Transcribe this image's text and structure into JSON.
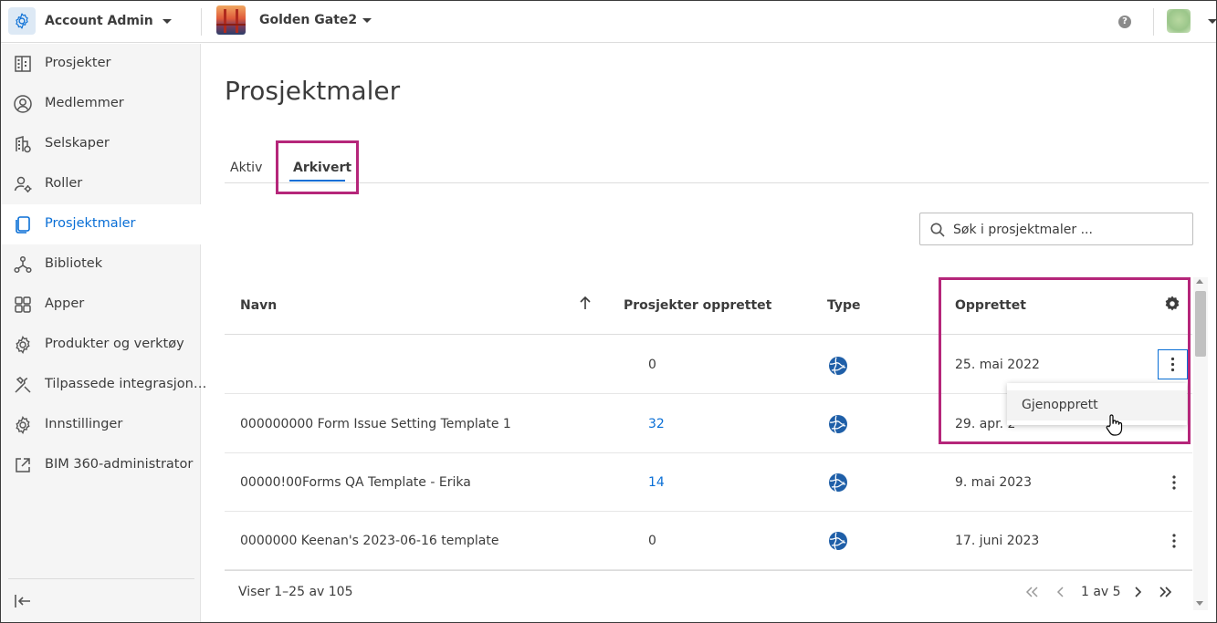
{
  "header": {
    "account_name": "Account Admin",
    "project_name": "Golden Gate2",
    "help_label": "?"
  },
  "sidebar": {
    "items": [
      {
        "label": "Prosjekter",
        "icon": "building-icon"
      },
      {
        "label": "Medlemmer",
        "icon": "user-circle-icon"
      },
      {
        "label": "Selskaper",
        "icon": "company-icon"
      },
      {
        "label": "Roller",
        "icon": "user-gear-icon"
      },
      {
        "label": "Prosjektmaler",
        "icon": "template-icon",
        "active": true
      },
      {
        "label": "Bibliotek",
        "icon": "library-icon"
      },
      {
        "label": "Apper",
        "icon": "apps-icon"
      },
      {
        "label": "Produkter og verktøy",
        "icon": "product-gear-icon"
      },
      {
        "label": "Tilpassede integrasjon…",
        "icon": "hammer-wrench-icon"
      },
      {
        "label": "Innstillinger",
        "icon": "gear-icon"
      },
      {
        "label": "BIM 360-administrator",
        "icon": "external-link-icon"
      }
    ]
  },
  "page": {
    "title": "Prosjektmaler",
    "tabs": [
      {
        "label": "Aktiv"
      },
      {
        "label": "Arkivert",
        "active": true
      }
    ],
    "search_placeholder": "Søk i prosjektmaler ..."
  },
  "table": {
    "columns": {
      "name": "Navn",
      "projects": "Prosjekter opprettet",
      "type": "Type",
      "created": "Opprettet"
    },
    "rows": [
      {
        "name": "",
        "projects": "0",
        "created": "25. mai 2022"
      },
      {
        "name": "000000000 Form Issue Setting Template 1",
        "projects": "32",
        "created": "29. apr. 2"
      },
      {
        "name": "00000!00Forms QA Template - Erika",
        "projects": "14",
        "created": "9. mai 2023"
      },
      {
        "name": "0000000 Keenan's 2023-06-16 template",
        "projects": "0",
        "created": "17. juni 2023"
      }
    ]
  },
  "context_menu": {
    "restore_label": "Gjenopprett"
  },
  "footer": {
    "showing": "Viser 1–25 av 105",
    "page_info": "1 av 5"
  },
  "colors": {
    "accent": "#0a6fd6",
    "highlight": "#b5267a",
    "globe": "#1f5fa8"
  }
}
